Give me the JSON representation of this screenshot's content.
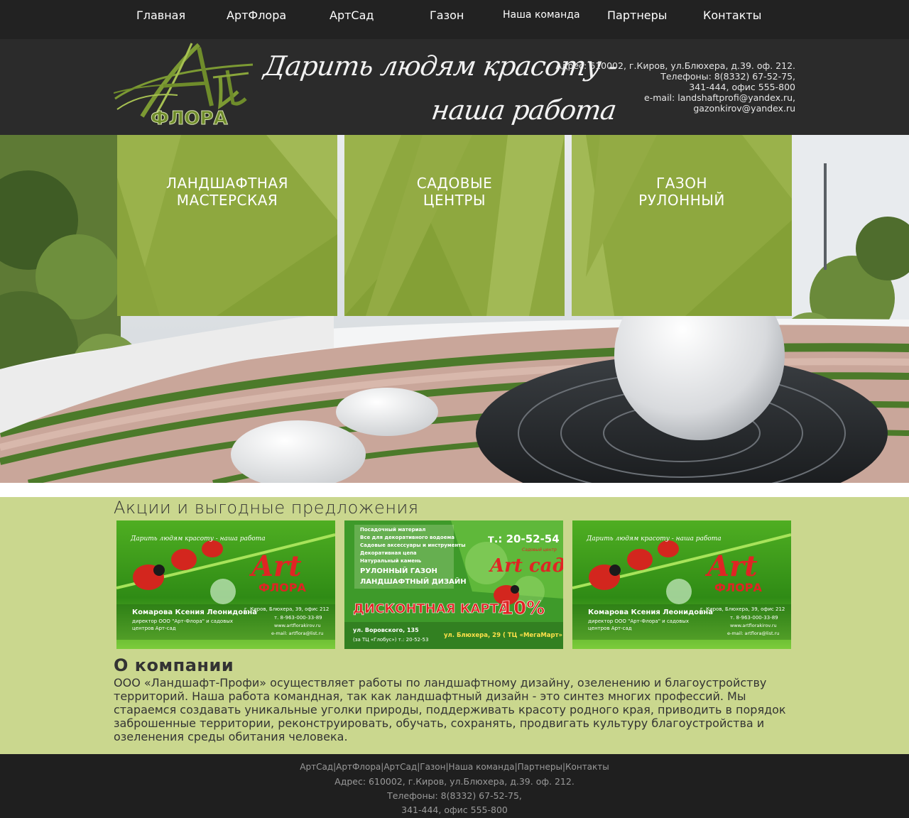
{
  "nav": {
    "items": [
      {
        "label": "Главная"
      },
      {
        "label": "АртФлора"
      },
      {
        "label": "АртСад"
      },
      {
        "label": "Газон"
      },
      {
        "label": "Наша команда"
      },
      {
        "label": "Партнеры"
      },
      {
        "label": "Контакты"
      }
    ]
  },
  "header": {
    "logo": {
      "word_art": "Art",
      "word_flora": "ФЛОРА",
      "color": "#6f8c2b"
    },
    "slogan": {
      "line1": "Дарить людям красоту -",
      "line2": "наша работа"
    },
    "contacts": {
      "address": "Адрес: 610002, г.Киров, ул.Блюхера, д.39. оф. 212.",
      "phones_line1": "Телефоны: 8(8332) 67-52-75,",
      "phones_line2": "341-444, офис 555-800",
      "email_line1": "e-mail: landshaftprofi@yandex.ru,",
      "email_line2": "gazonkirov@yandex.ru"
    }
  },
  "hero": {
    "tiles": [
      {
        "line1": "ЛАНДШАФТНАЯ",
        "line2": "МАСТЕРСКАЯ"
      },
      {
        "line1": "САДОВЫЕ",
        "line2": "ЦЕНТРЫ"
      },
      {
        "line1": "ГАЗОН",
        "line2": "РУЛОННЫЙ"
      }
    ],
    "tile_color": "#8ea83f"
  },
  "promo": {
    "title": "Акции и выгодные предложения",
    "cards": [
      {
        "kind": "business-card",
        "tagline": "Дарить людям красоту - наша работа",
        "brand_art": "Art",
        "brand_flora": "ФЛОРА",
        "name": "Комарова Ксения Леонидовна",
        "role1": "директор ООО \"Арт-Флора\" и садовых",
        "role2": "центров Арт-сад",
        "address": "г. Киров, Блюхера, 39, офис 212",
        "phone": "т. 8-963-000-33-89",
        "site": "www.artflorakirov.ru",
        "email": "e-mail: artflora@list.ru"
      },
      {
        "kind": "discount-card",
        "list": [
          "Посадочный материал",
          "Все для декоративного водоема",
          "Садовые аксессуары и инструменты",
          "Декоративная цепа",
          "Натуральный камень",
          "РУЛОННЫЙ ГАЗОН",
          "ЛАНДШАФТНЫЙ ДИЗАЙН"
        ],
        "phone": "т.: 20-52-54",
        "subbrand": "Садовый центр",
        "brand": "Art сад",
        "discount_title": "ДИСКОНТНАЯ КАРТА",
        "discount_value": "10%",
        "addr1": "ул. Воровского, 135",
        "addr1b": "(за ТЦ «Глобус») т.: 20-52-53",
        "addr2": "ул. Блюхера, 29 ( ТЦ «МегаМарт» )"
      },
      {
        "kind": "business-card",
        "tagline": "Дарить людям красоту - наша работа",
        "brand_art": "Art",
        "brand_flora": "ФЛОРА",
        "name": "Комарова Ксения Леонидовна",
        "role1": "директор ООО \"Арт-Флора\" и садовых",
        "role2": "центров Арт-сад",
        "address": "г. Киров, Блюхера, 39, офис 212",
        "phone": "т. 8-963-000-33-89",
        "site": "www.artflorakirov.ru",
        "email": "e-mail: artflora@list.ru"
      }
    ]
  },
  "about": {
    "title": "О компании",
    "text": "ООО «Ландшафт-Профи» осуществляет работы по ландшафтному дизайну, озеленению и благоустройству территорий. Наша работа командная, так как ландшафтный дизайн - это синтез многих профессий. Мы стараемся создавать уникальные уголки природы, поддерживать красоту родного края, приводить в порядок заброшенные территории, реконструировать, обучать, сохранять, продвигать культуру благоустройства и озеленения среды обитания человека."
  },
  "footer": {
    "links": [
      {
        "label": "АртСад"
      },
      {
        "label": "АртФлора"
      },
      {
        "label": "АртСад"
      },
      {
        "label": "Газон"
      },
      {
        "label": "Наша команда"
      },
      {
        "label": "Партнеры"
      },
      {
        "label": "Контакты"
      }
    ],
    "separator": "|",
    "address": "Адрес: 610002, г.Киров, ул.Блюхера, д.39. оф. 212.",
    "phones_line1": "Телефоны: 8(8332) 67-52-75,",
    "phones_line2": "341-444, офис 555-800"
  },
  "colors": {
    "nav_bg": "#222222",
    "header_bg": "#2b2b2b",
    "accent_green": "#8ea83f",
    "promo_bg": "#cad78e",
    "footer_bg": "#1f1f1f"
  }
}
